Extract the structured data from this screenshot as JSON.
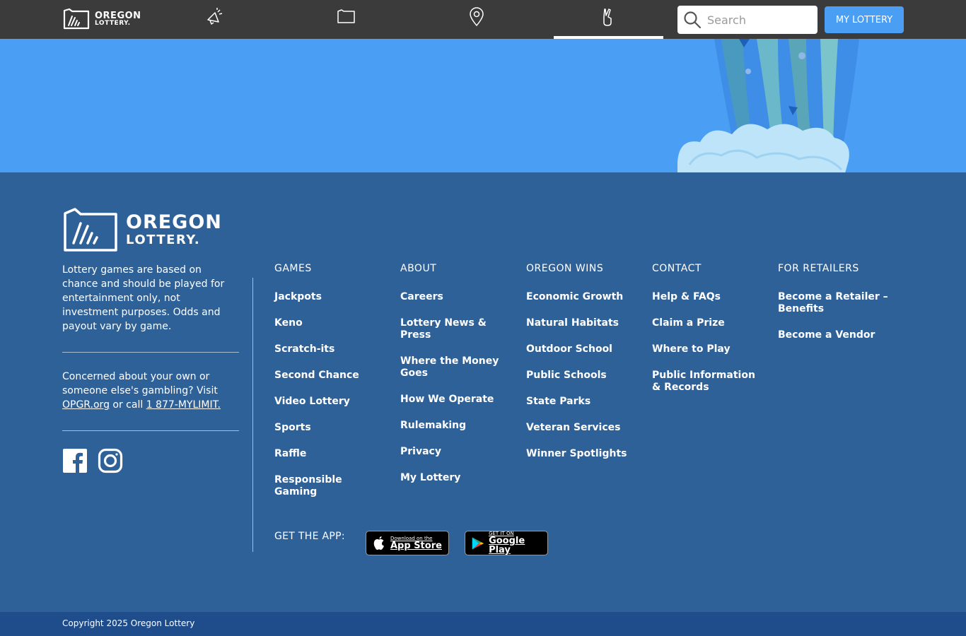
{
  "header": {
    "logo": {
      "line1": "OREGON",
      "line2": "LOTTERY."
    },
    "nav_icons": [
      "megaphone-icon",
      "oregon-map-icon",
      "location-pin-icon",
      "crossed-fingers-icon"
    ],
    "active_nav": "crossed-fingers-icon",
    "search": {
      "placeholder": "Search",
      "value": ""
    },
    "my_lottery_label": "MY LOTTERY"
  },
  "footer": {
    "logo": {
      "line1": "OREGON",
      "line2": "LOTTERY."
    },
    "disclaimer": "Lottery games are based on chance and should be played for entertainment only, not investment purposes. Odds and payout vary by game.",
    "concern": {
      "text_before": "Concerned about your own or someone else's gambling? Visit ",
      "link1": "OPGR.org",
      "text_middle": " or call ",
      "link2": "1 877-MYLIMIT."
    },
    "social_icons": [
      "facebook-icon",
      "instagram-icon"
    ],
    "columns": [
      {
        "heading": "GAMES",
        "items": [
          "Jackpots",
          "Keno",
          "Scratch-its",
          "Second Chance",
          "Video Lottery",
          "Sports",
          "Raffle",
          "Responsible Gaming"
        ]
      },
      {
        "heading": "ABOUT",
        "items": [
          "Careers",
          "Lottery News & Press",
          "Where the Money Goes",
          "How We Operate",
          "Rulemaking",
          "Privacy",
          "My Lottery"
        ]
      },
      {
        "heading": "OREGON WINS",
        "items": [
          "Economic Growth",
          "Natural Habitats",
          "Outdoor School",
          "Public Schools",
          "State Parks",
          "Veteran Services",
          "Winner Spotlights"
        ]
      },
      {
        "heading": "CONTACT",
        "items": [
          "Help & FAQs",
          "Claim a Prize",
          "Where to Play",
          "Public Information & Records"
        ]
      },
      {
        "heading": "FOR RETAILERS",
        "items": [
          "Become a Retailer – Benefits",
          "Become a Vendor"
        ]
      }
    ],
    "get_app_label": "GET THE APP:",
    "app_store": {
      "small": "Download on the",
      "big": "App Store"
    },
    "google_play": {
      "small": "GET IT ON",
      "big": "Google Play"
    }
  },
  "copyright": "Copyright 2025 Oregon Lottery",
  "colors": {
    "header_bg": "#3b3b3b",
    "hero_bg": "#4a9ff5",
    "footer_bg": "#2f6199",
    "copyright_bg": "#1f4d8c",
    "accent": "#4a9ff5"
  }
}
